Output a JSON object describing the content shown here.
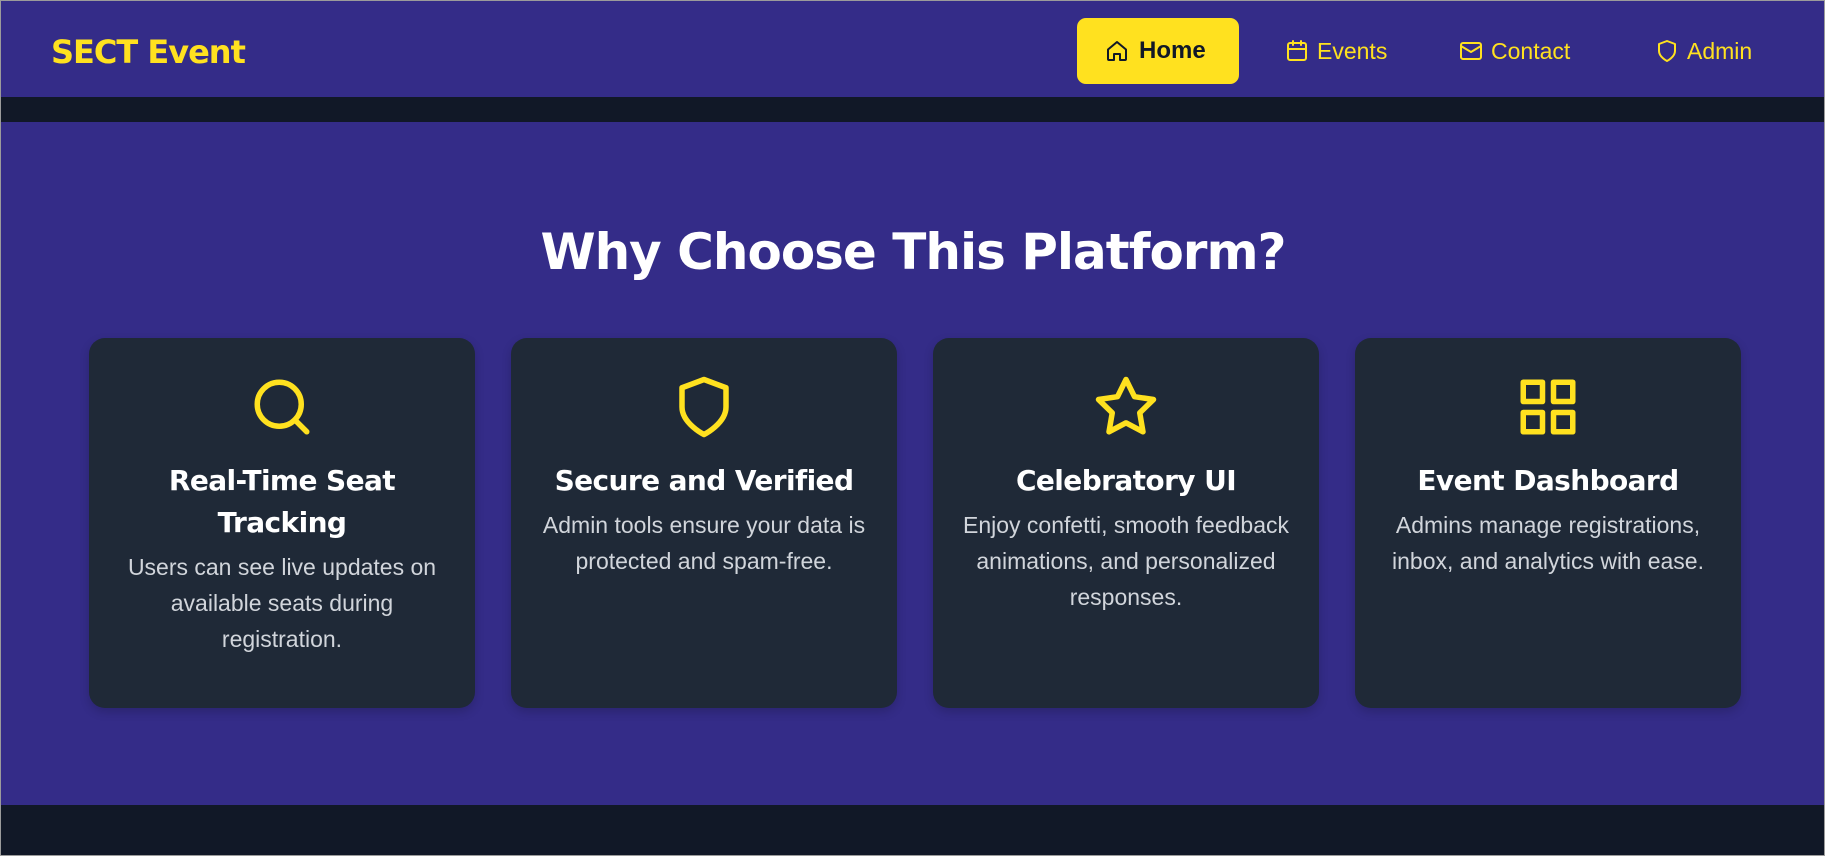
{
  "header": {
    "brand": "SECT Event",
    "nav": [
      {
        "label": "Home",
        "icon": "home-icon",
        "active": true
      },
      {
        "label": "Events",
        "icon": "calendar-icon",
        "active": false
      },
      {
        "label": "Contact",
        "icon": "mail-icon",
        "active": false
      },
      {
        "label": "Admin",
        "icon": "shield-icon",
        "active": false
      }
    ]
  },
  "features": {
    "title": "Why Choose This Platform?",
    "cards": [
      {
        "icon": "search-icon",
        "title": "Real-Time Seat Tracking",
        "text": "Users can see live updates on available seats during registration."
      },
      {
        "icon": "shield-icon",
        "title": "Secure and Verified",
        "text": "Admin tools ensure your data is protected and spam-free."
      },
      {
        "icon": "star-icon",
        "title": "Celebratory UI",
        "text": "Enjoy confetti, smooth feedback animations, and personalized responses."
      },
      {
        "icon": "grid-icon",
        "title": "Event Dashboard",
        "text": "Admins manage registrations, inbox, and analytics with ease."
      }
    ]
  },
  "colors": {
    "primary_bg": "#342c88",
    "accent": "#ffe11f",
    "card_bg": "#1f2937",
    "dark_bg": "#111827",
    "text_light": "#d1d5db"
  }
}
